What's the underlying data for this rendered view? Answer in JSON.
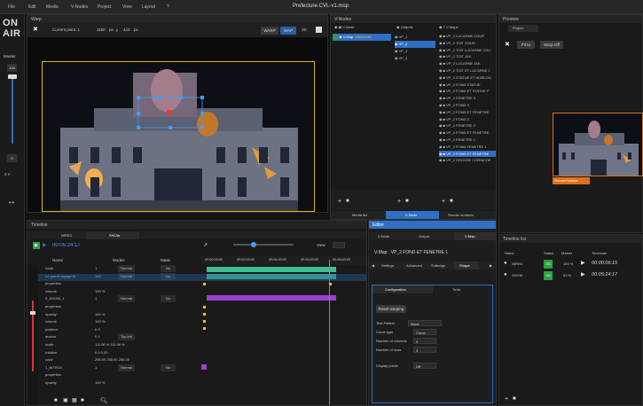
{
  "menubar": {
    "items": [
      "File",
      "Edit",
      "Media",
      "V-Nodes",
      "Project",
      "View",
      "Layout",
      "?"
    ],
    "title": "Prefecture-CVL-v1.mop"
  },
  "logo": {
    "line1": "ON",
    "line2": "AIR"
  },
  "leftstrip": {
    "master_label": "Master",
    "level_value": "100",
    "zero_value": "0",
    "speed": "2 x"
  },
  "warp": {
    "title": "Warp",
    "current_point": "Current point: 1",
    "x_value": "1190",
    "px": "px",
    "y_label": "y",
    "y_value": "443",
    "y_px": "px",
    "warp_btn": "WARP",
    "map_btn": "MAP",
    "three_d": "3D"
  },
  "vnodes": {
    "title": "V-Nodes",
    "header_vnode": "V-Node",
    "selected_vnode": "V-Map",
    "res": "1920x1080",
    "header_outputs": "Outputs",
    "outputs": [
      "VP_1",
      "VP_2",
      "VP_3",
      "VP_4"
    ],
    "header_vmaps": "V-Maps",
    "vmaps": [
      "VP_2 LUCARNE COUR",
      "VP_2 TOIT COUR",
      "VP_2 TOIT LUCARNE COU",
      "VP_2 TOIT JAK",
      "VP_2 LUCARNE JAK",
      "VP_2 TOIT ET LUCARNE J",
      "VP_2 STATUE ET HORLOG",
      "VP_2 FOND STATUE",
      "VP_2 FOND ET STATUE F",
      "VP_2 FENETRE 3",
      "VP_2 FOND 3",
      "VP_2 FOND ET FENETRE",
      "VP_2 FOND 2",
      "VP_2 FENETRE 2",
      "VP_2 FOND ET FENETRE",
      "VP_2 FENETRE 1",
      "VP_2 FOND FENETRE 1",
      "VP_2 FOND ET FENETRE",
      "VP_2 GROSSE CORNICHE"
    ],
    "tabs": [
      "Media list",
      "V-Node",
      "Render surfaces"
    ]
  },
  "preview": {
    "title": "Preview",
    "tab": "Project",
    "fit_btn": "Fit to",
    "warp_btn": "Warp Off",
    "render_label": "RenderSurface"
  },
  "timeline": {
    "title": "Timeline",
    "tabs": [
      "NIRED",
      "SHOW"
    ],
    "timecode": "00:05:24:17",
    "col_name": "Name",
    "col_modes": "Modes",
    "col_mask": "Mask",
    "view_label": "View",
    "ticks": [
      "00:00:00:00",
      "00:02:00:00",
      "00:04:00:00",
      "00:06:00:00",
      "00:08:00:00"
    ],
    "rows": [
      {
        "name": "Solid",
        "val": "1",
        "mode": "Normal",
        "mask": "No"
      },
      {
        "name": "Le grand voyage M",
        "val": "100",
        "mode": "Normal",
        "mask": "No"
      },
      {
        "name": "properties",
        "val": "",
        "mode": "",
        "mask": ""
      },
      {
        "name": "volume",
        "val": "100 %",
        "mode": "",
        "mask": ""
      },
      {
        "name": "Z_SHOW_1",
        "val": "1",
        "mode": "Normal",
        "mask": "No"
      },
      {
        "name": "properties",
        "val": "",
        "mode": "",
        "mask": ""
      },
      {
        "name": "opacity",
        "val": "100 %",
        "mode": "",
        "mask": ""
      },
      {
        "name": "volume",
        "val": "100 %",
        "mode": "",
        "mask": ""
      },
      {
        "name": "position",
        "val": "0   0",
        "mode": "",
        "mask": ""
      },
      {
        "name": "anchor",
        "val": "0   0",
        "mode": "Top left",
        "mask": ""
      },
      {
        "name": "scale",
        "val": "111.06 %  111.06 %",
        "mode": "",
        "mask": ""
      },
      {
        "name": "rotation",
        "val": "0   0   0.00",
        "mode": "",
        "mask": ""
      },
      {
        "name": "color",
        "val": "255.00  255.00  255.00",
        "mode": "",
        "mask": ""
      },
      {
        "name": "1_INTRO1",
        "val": "1",
        "mode": "Normal",
        "mask": "No"
      },
      {
        "name": "properties",
        "val": "",
        "mode": "",
        "mask": ""
      },
      {
        "name": "opacity",
        "val": "100 %",
        "mode": "",
        "mask": ""
      }
    ]
  },
  "editor": {
    "title": "Editor",
    "tabs": [
      "V-Node",
      "Output",
      "V-Map"
    ],
    "vmap_title": "V-Map : VP_2 FOND ET FENETRE 1",
    "subtabs": [
      "Settings",
      "Advanced",
      "Softedge",
      "Shape"
    ],
    "config_tabs": [
      "Configuration",
      "Tools"
    ],
    "reset_btn": "Reset warping",
    "test_pattern_label": "Test Pattern",
    "test_pattern_value": "None",
    "curve_label": "Curve type",
    "curve_value": "Curve",
    "cols_label": "Number of columns",
    "cols_value": "3",
    "rows_label": "Number of rows",
    "rows_value": "3",
    "display_label": "Display points",
    "display_value": "Off"
  },
  "timeline_list": {
    "title": "Timeline list",
    "col_name": "Name",
    "col_status": "Status",
    "col_master": "Master",
    "col_timecode": "Timecode",
    "rows": [
      {
        "name": "NIRED",
        "status": "ON",
        "master": "100 %",
        "tc": "00:00:06:15"
      },
      {
        "name": "SHOW",
        "status": "ON",
        "master": "92 %",
        "tc": "00:05:24:17"
      }
    ]
  },
  "colors": {
    "accent": "#2f6fc4",
    "green": "#2ea043",
    "orange": "#e0701a",
    "bar_green": "#3fbf8f",
    "bar_purple": "#9b3fd1",
    "keyframe": "#e8c41a"
  }
}
